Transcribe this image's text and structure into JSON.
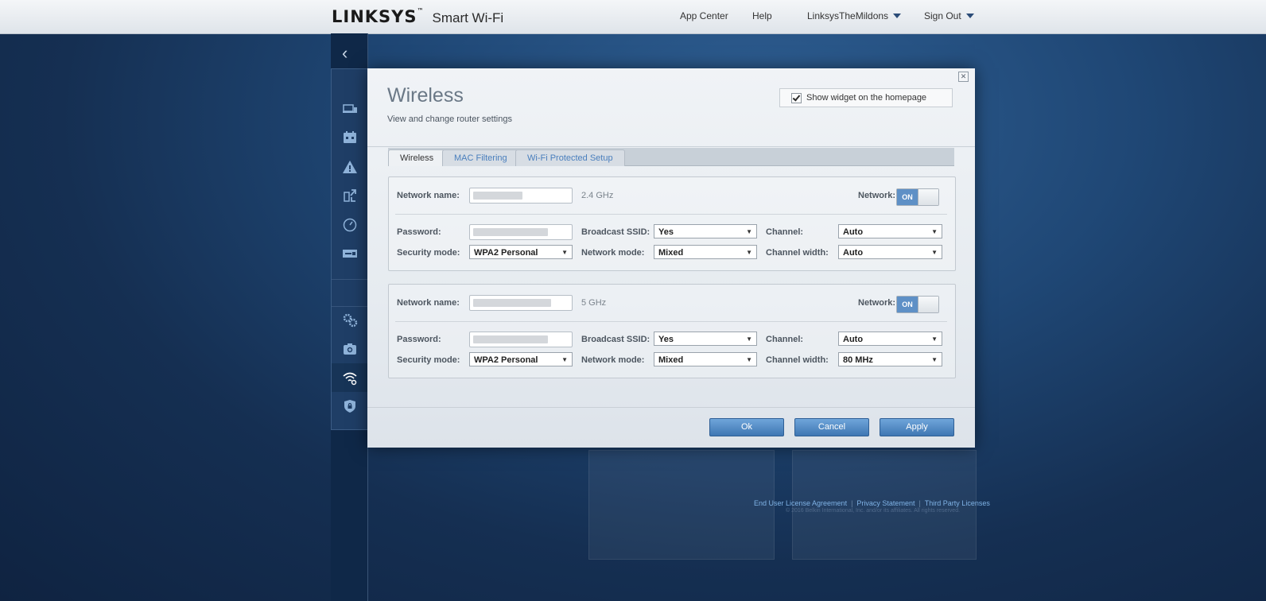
{
  "header": {
    "logo": "LINKSYS",
    "trademark": "™",
    "product": "Smart Wi-Fi",
    "nav": {
      "app_center": "App Center",
      "help": "Help",
      "account": "LinksysTheMildons",
      "sign_out": "Sign Out"
    }
  },
  "sidebar": {
    "back": "‹",
    "icons": [
      "device-list-icon",
      "guest-access-icon",
      "parental-controls-icon",
      "media-prioritization-icon",
      "speed-test-icon",
      "external-storage-icon",
      "connectivity-icon",
      "troubleshooting-icon",
      "wireless-icon",
      "security-icon"
    ],
    "active": "wireless-icon"
  },
  "modal": {
    "title": "Wireless",
    "subtitle": "View and change router settings",
    "close": "✕",
    "show_widget_label": "Show widget on the homepage",
    "show_widget_checked": true,
    "tabs": [
      {
        "label": "Wireless",
        "active": true
      },
      {
        "label": "MAC Filtering",
        "active": false
      },
      {
        "label": "Wi-Fi Protected Setup",
        "active": false
      }
    ],
    "labels": {
      "network_name": "Network name:",
      "password": "Password:",
      "security_mode": "Security mode:",
      "broadcast_ssid": "Broadcast SSID:",
      "network_mode": "Network mode:",
      "channel": "Channel:",
      "channel_width": "Channel width:",
      "network": "Network:"
    },
    "bands": [
      {
        "band": "2.4 GHz",
        "network_toggle": "ON",
        "security_mode": "WPA2 Personal",
        "broadcast_ssid": "Yes",
        "network_mode": "Mixed",
        "channel": "Auto",
        "channel_width": "Auto"
      },
      {
        "band": "5 GHz",
        "network_toggle": "ON",
        "security_mode": "WPA2 Personal",
        "broadcast_ssid": "Yes",
        "network_mode": "Mixed",
        "channel": "Auto",
        "channel_width": "80 MHz"
      }
    ],
    "buttons": {
      "ok": "Ok",
      "cancel": "Cancel",
      "apply": "Apply"
    }
  },
  "footer": {
    "eula": "End User License Agreement",
    "privacy": "Privacy Statement",
    "third_party": "Third Party Licenses",
    "copyright": "© 2016 Belkin International, Inc. and/or its affiliates. All rights reserved."
  },
  "colors": {
    "accent": "#4a7fbd",
    "toggle_on": "#5e90c6",
    "button": "#4a84c2",
    "background_dark": "#152f52"
  }
}
